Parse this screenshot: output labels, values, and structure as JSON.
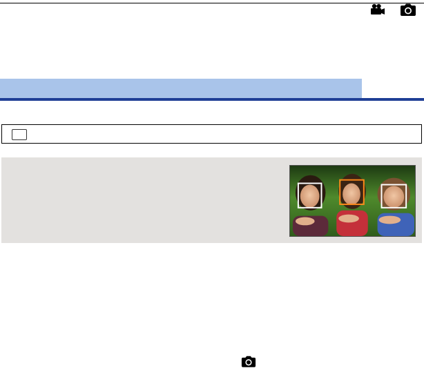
{
  "header": {
    "title": "",
    "mode_icons": [
      "video-camera-icon",
      "still-camera-icon"
    ],
    "header_color": "#a9c4ea",
    "underline_color": "#1f3f96"
  },
  "menu_path": {
    "text": ""
  },
  "info_box": {
    "text": "",
    "background": "#e3e1df",
    "face_frame_selected_color": "#ff8a1a",
    "face_frame_color": "#ffffff"
  },
  "bottom": {
    "icon": "still-camera-icon"
  }
}
